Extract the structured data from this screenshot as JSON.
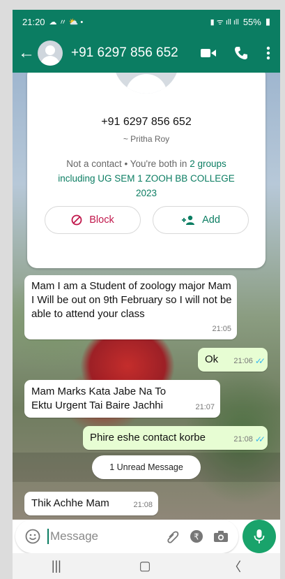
{
  "status": {
    "time": "21:20",
    "left_icons": "☁ 〃 ⛅ •",
    "battery": "55%"
  },
  "header": {
    "title": "+91 6297 856 652"
  },
  "card": {
    "phone": "+91 6297 856 652",
    "name": "~ Pritha Roy",
    "note_prefix": "Not a contact • You're both in ",
    "note_group_link": "2 groups including UG SEM 1 ZOOH BB COLLEGE 2023",
    "block_label": "Block",
    "add_label": "Add"
  },
  "messages": [
    {
      "text": "Mam I am a Student of zoology major Mam I Will be out on 9th February so I will not be able to attend your class",
      "time": "21:05",
      "dir": "in"
    },
    {
      "text": "Ok",
      "time": "21:06",
      "dir": "out"
    },
    {
      "text": "Mam Marks Kata Jabe Na To Ektu Urgent Tai Baire Jachhi",
      "time": "21:07",
      "dir": "in"
    },
    {
      "text": "Phire eshe contact korbe",
      "time": "21:08",
      "dir": "out"
    },
    {
      "text": "Thik Achhe Mam",
      "time": "21:08",
      "dir": "in"
    }
  ],
  "unread": "1 Unread Message",
  "input": {
    "placeholder": "Message"
  },
  "colors": {
    "brand": "#0b7d62",
    "out_bubble": "#e7fdd3",
    "block": "#c1174b",
    "mic": "#19a36b"
  }
}
